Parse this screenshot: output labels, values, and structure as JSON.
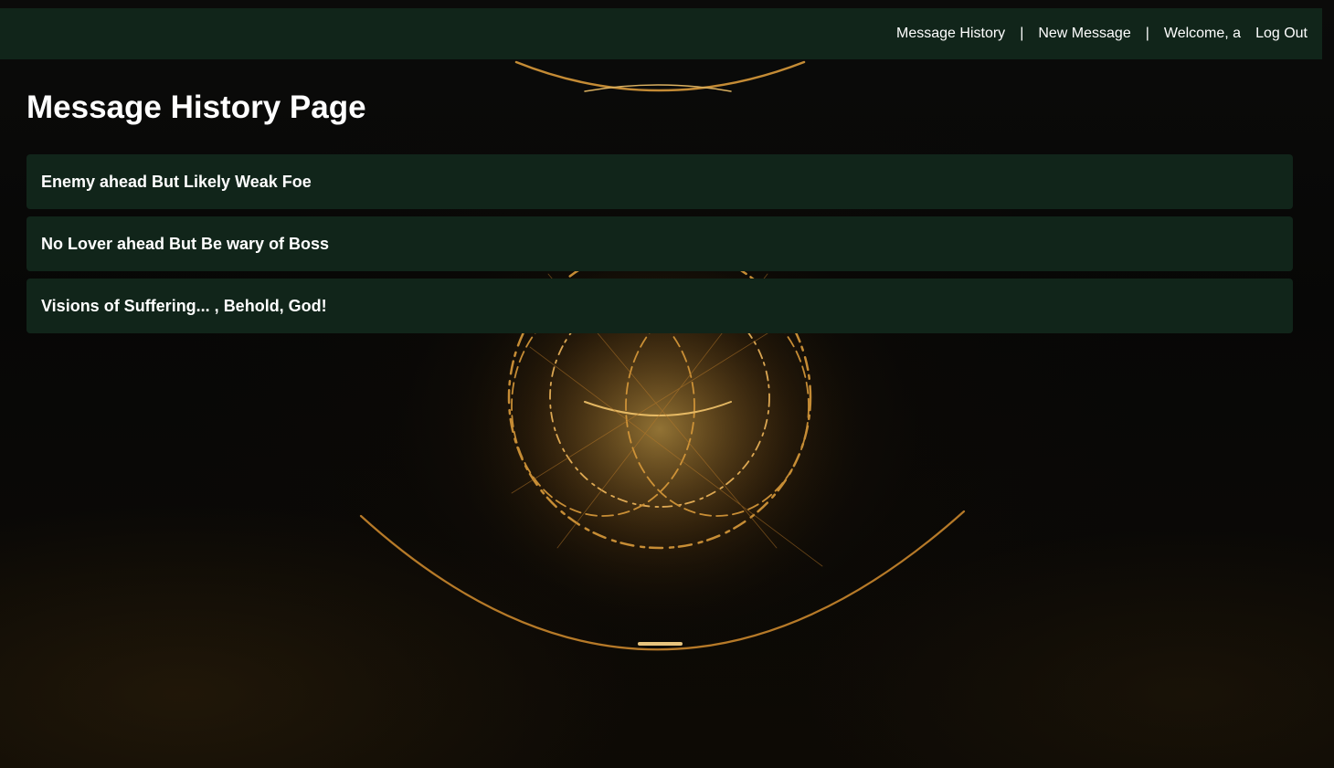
{
  "nav": {
    "message_history": "Message History",
    "separator": "|",
    "new_message": "New Message",
    "welcome": "Welcome, a",
    "logout": "Log Out"
  },
  "main": {
    "title": "Message History Page",
    "messages": [
      "Enemy ahead But Likely Weak Foe",
      "No Lover ahead But Be wary of Boss",
      "Visions of Suffering... , Behold, God!"
    ]
  },
  "colors": {
    "bar": "#11251a",
    "card": "#11251a",
    "text": "#ffffff",
    "glow": "#e0a640"
  }
}
